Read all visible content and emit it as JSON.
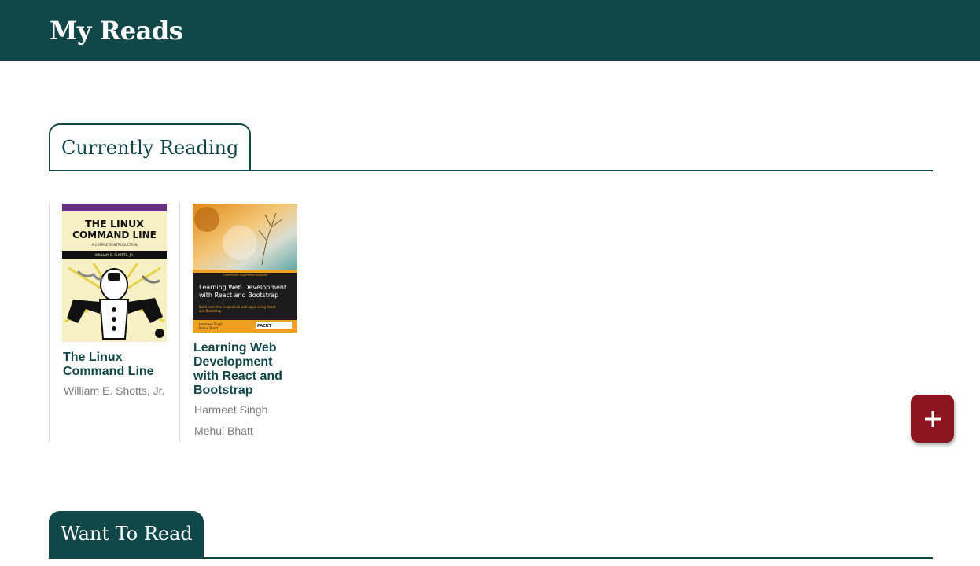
{
  "app": {
    "title": "My Reads"
  },
  "shelves": [
    {
      "title": "Currently Reading",
      "books": [
        {
          "title": "The Linux Command Line",
          "authors": [
            "William E. Shotts, Jr."
          ],
          "cover": {
            "line1": "THE LINUX",
            "line2": "COMMAND LINE",
            "subtitle": "A COMPLETE INTRODUCTION",
            "author": "WILLIAM E. SHOTTS, JR."
          }
        },
        {
          "title": "Learning Web Development with React and Bootstrap",
          "authors": [
            "Harmeet Singh",
            "Mehul Bhatt"
          ],
          "cover": {
            "series": "Community Experience Distilled",
            "title": "Learning Web Development with React and Bootstrap",
            "tagline": "Build real-time responsive web apps using React and Bootstrap",
            "authors": "Harmeet Singh / Mehul Bhatt",
            "publisher": "PACKT"
          }
        }
      ]
    },
    {
      "title": "Want To Read",
      "books": []
    }
  ],
  "fab": {
    "icon": "plus-icon",
    "color": "#8b1620"
  },
  "colors": {
    "primary": "#124749",
    "accent": "#8b1620",
    "muted": "#7a7a7a"
  }
}
